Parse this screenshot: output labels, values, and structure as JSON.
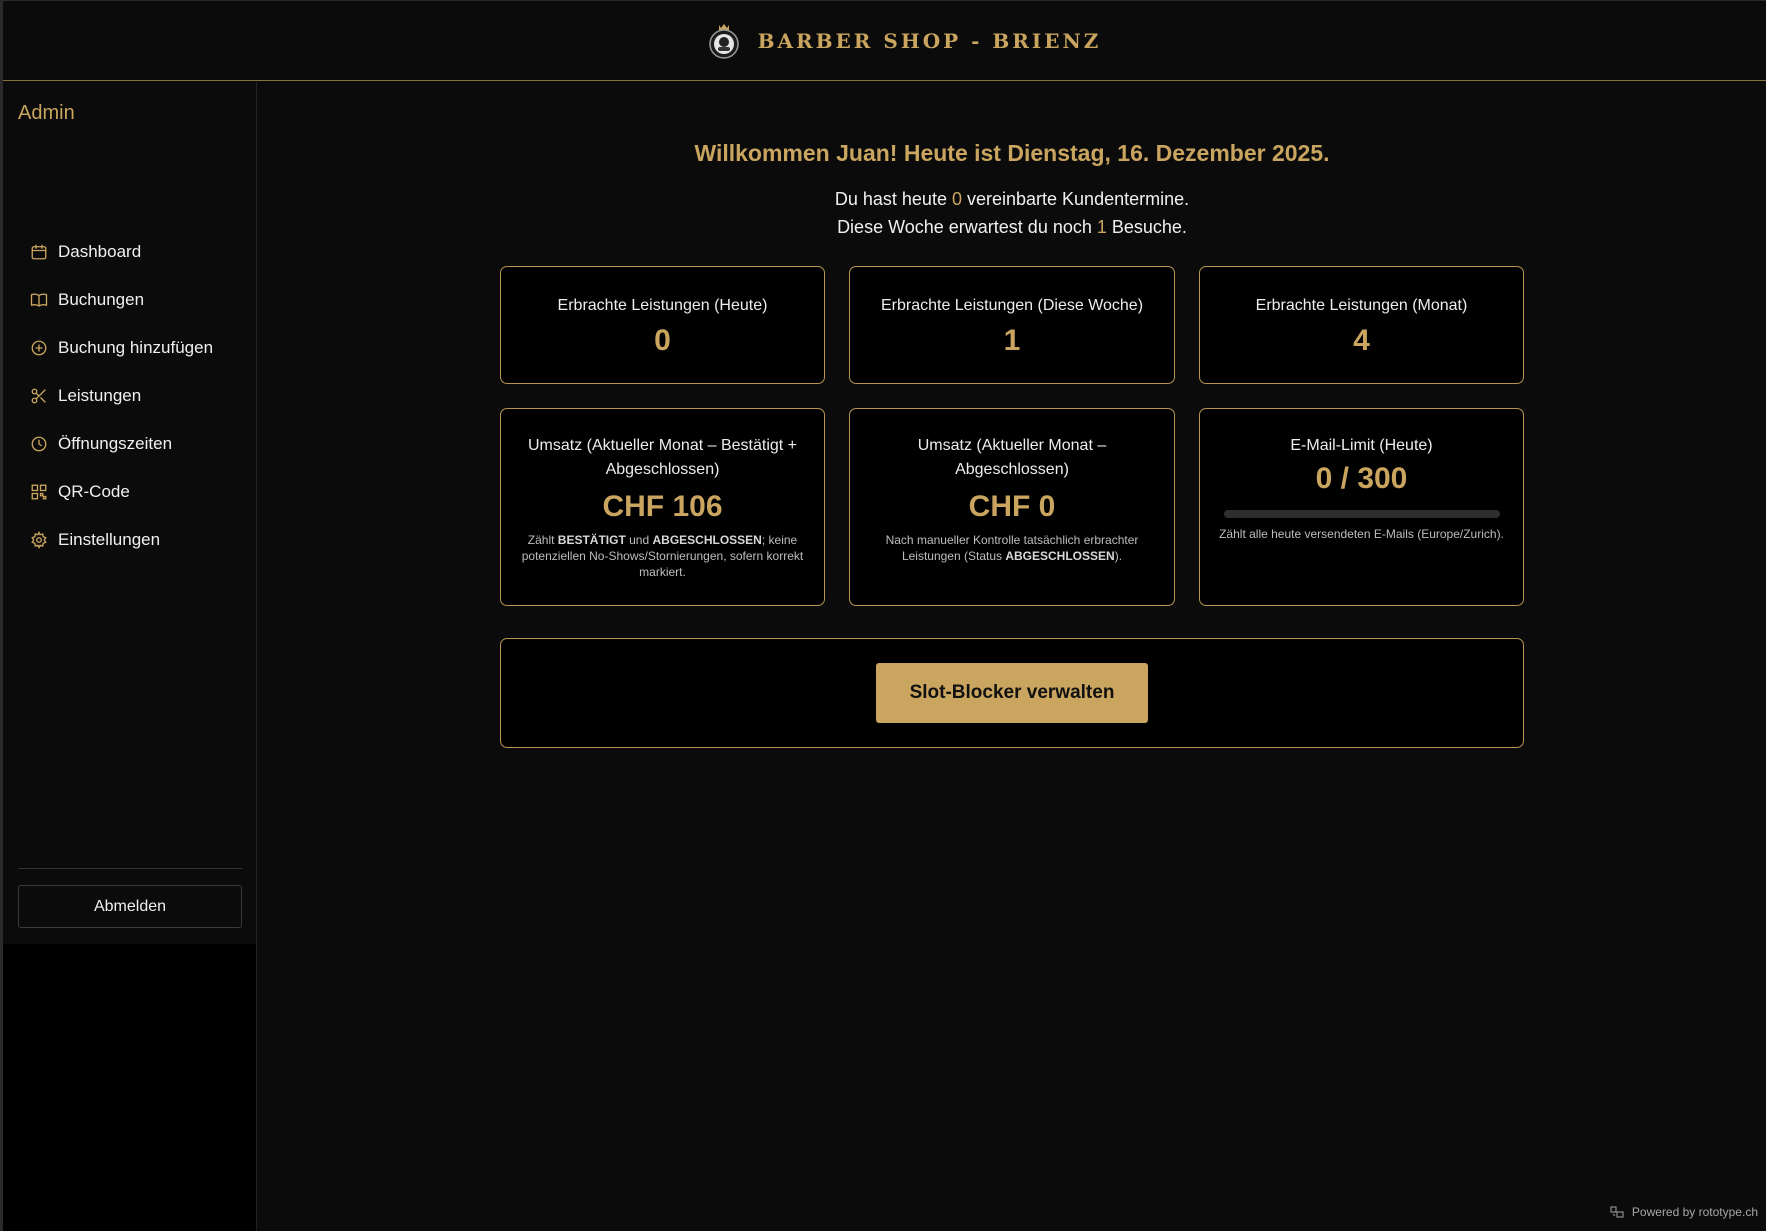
{
  "header": {
    "brand": "BARBER SHOP - BRIENZ"
  },
  "sidebar": {
    "title": "Admin",
    "items": [
      {
        "label": "Dashboard",
        "icon": "calendar-icon"
      },
      {
        "label": "Buchungen",
        "icon": "book-icon"
      },
      {
        "label": "Buchung hinzufügen",
        "icon": "plus-circle-icon"
      },
      {
        "label": "Leistungen",
        "icon": "scissors-icon"
      },
      {
        "label": "Öffnungszeiten",
        "icon": "clock-icon"
      },
      {
        "label": "QR-Code",
        "icon": "qr-code-icon"
      },
      {
        "label": "Einstellungen",
        "icon": "gear-icon"
      }
    ],
    "logout_label": "Abmelden"
  },
  "welcome": {
    "prefix": "Willkommen Juan! Heute ist ",
    "date": "Dienstag, 16. Dezember 2025",
    "suffix": ".",
    "line1_before": "Du hast heute ",
    "line1_count": "0",
    "line1_after": " vereinbarte Kundentermine.",
    "line2_before": "Diese Woche erwartest du noch ",
    "line2_count": "1",
    "line2_after": " Besuche."
  },
  "stats": {
    "today": {
      "title": "Erbrachte Leistungen (Heute)",
      "value": "0"
    },
    "week": {
      "title": "Erbrachte Leistungen (Diese Woche)",
      "value": "1"
    },
    "month": {
      "title": "Erbrachte Leistungen (Monat)",
      "value": "4"
    }
  },
  "revenue_confirmed": {
    "title": "Umsatz (Aktueller Monat – Bestätigt + Abgeschlossen)",
    "value": "CHF 106",
    "note_1": "Zählt ",
    "note_b1": "BESTÄTIGT",
    "note_2": " und ",
    "note_b2": "ABGESCHLOSSEN",
    "note_3": "; keine potenziellen No-Shows/Stornierungen, sofern korrekt markiert."
  },
  "revenue_completed": {
    "title": "Umsatz (Aktueller Monat – Abgeschlossen)",
    "value": "CHF 0",
    "note_1": "Nach manueller Kontrolle tatsächlich erbrachter Leistungen (Status ",
    "note_b1": "ABGESCHLOSSEN",
    "note_2": ")."
  },
  "email_limit": {
    "title": "E-Mail-Limit (Heute)",
    "value": "0 / 300",
    "used_fraction": 0,
    "note": "Zählt alle heute versendeten E-Mails (Europe/Zurich)."
  },
  "slot_blocker": {
    "button_label": "Slot-Blocker verwalten"
  },
  "footer": {
    "powered": "Powered by rototype.ch"
  },
  "colors": {
    "accent": "#c9a55f",
    "background": "#0b0b0b",
    "card": "#000000"
  }
}
